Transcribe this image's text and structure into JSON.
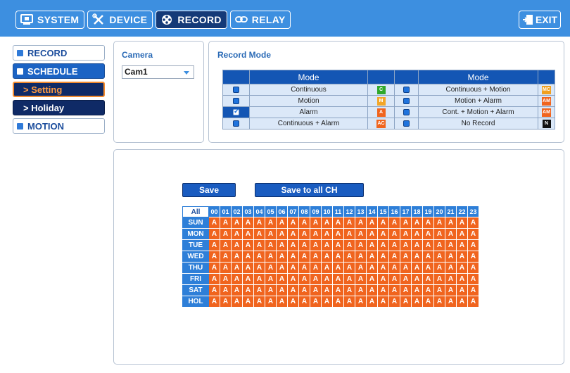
{
  "topbar": {
    "tabs": [
      {
        "label": "SYSTEM",
        "icon": "monitor-icon",
        "active": false
      },
      {
        "label": "DEVICE",
        "icon": "tools-icon",
        "active": false
      },
      {
        "label": "RECORD",
        "icon": "film-reel-icon",
        "active": true
      },
      {
        "label": "RELAY",
        "icon": "link-icon",
        "active": false
      }
    ],
    "exit_label": "EXIT"
  },
  "sidebar": {
    "record": "RECORD",
    "schedule": "SCHEDULE",
    "setting": "> Setting",
    "holiday": "> Holiday",
    "motion": "MOTION"
  },
  "camera": {
    "title": "Camera",
    "selected": "Cam1"
  },
  "record_mode": {
    "title": "Record Mode",
    "header": "Mode",
    "rows": [
      {
        "left": {
          "label": "Continuous",
          "badge": "C",
          "color": "#2fa82a",
          "checked": false
        },
        "right": {
          "label": "Continuous + Motion",
          "badge": "MC",
          "color": "#f0a020",
          "checked": false
        }
      },
      {
        "left": {
          "label": "Motion",
          "badge": "M",
          "color": "#f2a628",
          "checked": false
        },
        "right": {
          "label": "Motion + Alarm",
          "badge": "AM",
          "color": "#f0641e",
          "checked": false
        }
      },
      {
        "left": {
          "label": "Alarm",
          "badge": "A",
          "color": "#f0641e",
          "checked": true
        },
        "right": {
          "label": "Cont. + Motion + Alarm",
          "badge": "AM",
          "color": "#f0641e",
          "checked": false
        }
      },
      {
        "left": {
          "label": "Continuous + Alarm",
          "badge": "AC",
          "color": "#f0641e",
          "checked": false
        },
        "right": {
          "label": "No Record",
          "badge": "N",
          "color": "#111111",
          "checked": false
        }
      }
    ]
  },
  "schedule": {
    "save_label": "Save",
    "save_all_label": "Save to all CH",
    "all_label": "All",
    "hours": [
      "00",
      "01",
      "02",
      "03",
      "04",
      "05",
      "06",
      "07",
      "08",
      "09",
      "10",
      "11",
      "12",
      "13",
      "14",
      "15",
      "16",
      "17",
      "18",
      "19",
      "20",
      "21",
      "22",
      "23"
    ],
    "days": [
      "SUN",
      "MON",
      "TUE",
      "WED",
      "THU",
      "FRI",
      "SAT",
      "HOL"
    ],
    "cell_value": "A",
    "cell_color": "#f0641e"
  }
}
